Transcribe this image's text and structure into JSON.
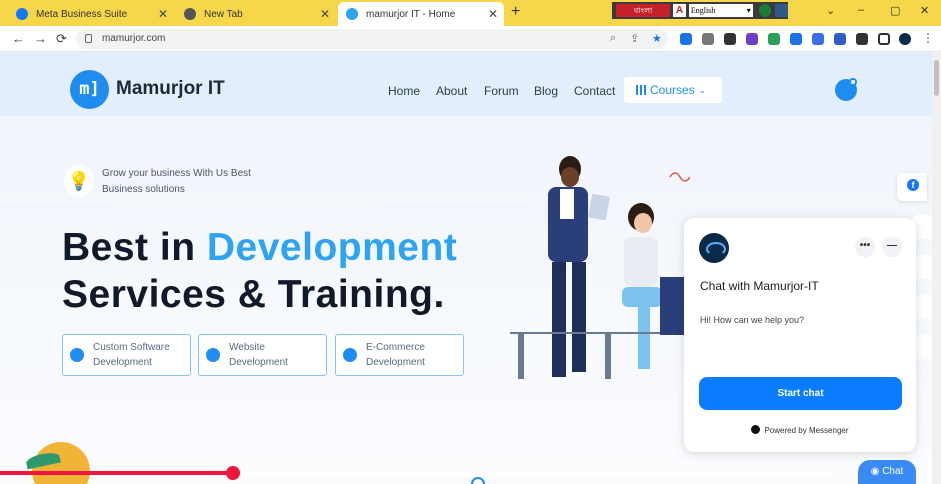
{
  "browser": {
    "tabs": [
      {
        "title": "Meta Business Suite",
        "active": false
      },
      {
        "title": "New Tab",
        "active": false
      },
      {
        "title": "mamurjor IT - Home",
        "active": true
      }
    ],
    "new_tab": "+",
    "language_bar": {
      "lang_name": "বাংলা",
      "a_glyph": "A",
      "selected_language": "English"
    },
    "window_controls": {
      "chevron": "⌄",
      "minimize": "–",
      "maximize": "▢",
      "close": "✕"
    },
    "url": "mamurjor.com",
    "nav": {
      "back": "←",
      "forward": "→",
      "reload": "⟳"
    }
  },
  "site": {
    "logo_mark": "m]",
    "logo_text": "Mamurjor IT",
    "menu": [
      "Home",
      "About",
      "Forum",
      "Blog",
      "Contact"
    ],
    "courses_label": "Courses",
    "tagline_line1": "Grow your business With Us Best",
    "tagline_line2": "Business solutions",
    "hero_word1": "Best in ",
    "hero_accent": "Development",
    "hero_line2": "Services & Training.",
    "services": [
      {
        "line1": "Custom Software",
        "line2": "Development"
      },
      {
        "line1": "Website",
        "line2": "Development"
      },
      {
        "line1": "E-Commerce",
        "line2": "Development"
      }
    ]
  },
  "chat": {
    "title": "Chat with Mamurjor-IT",
    "message": "Hi! How can we help you?",
    "more_glyph": "•••",
    "minimize_glyph": "—",
    "start_button": "Start chat",
    "powered_by": "Powered by Messenger",
    "fab_label": "Chat"
  },
  "video": {
    "progress_fraction": 0.28
  },
  "colors": {
    "accent": "#1f8cf0",
    "hero_accent": "#2ea3f2",
    "tabbar": "#f7d74a",
    "messenger_blue": "#0a7cff",
    "progress_red": "#f1143c"
  }
}
